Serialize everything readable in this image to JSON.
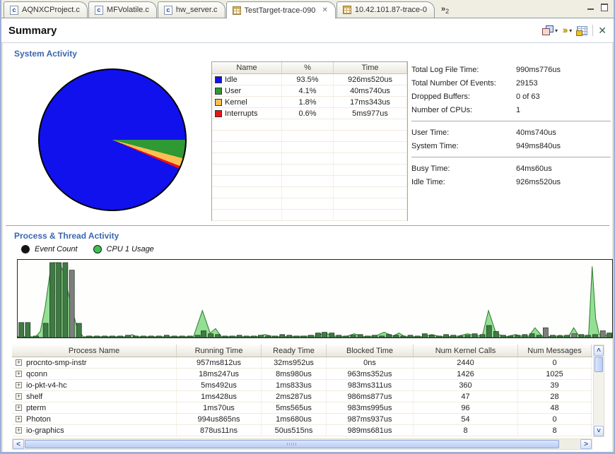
{
  "tabs": [
    {
      "label": "AQNXCProject.c",
      "icon": "c-file-icon",
      "active": false,
      "closable": false
    },
    {
      "label": "MFVolatile.c",
      "icon": "c-file-icon",
      "active": false,
      "closable": false
    },
    {
      "label": "hw_server.c",
      "icon": "c-file-icon",
      "active": false,
      "closable": false
    },
    {
      "label": "TestTarget-trace-090",
      "icon": "trace-file-icon",
      "active": true,
      "closable": true
    },
    {
      "label": "10.42.101.87-trace-0",
      "icon": "trace-file-icon",
      "active": false,
      "closable": false
    }
  ],
  "tab_overflow_count": "2",
  "header": {
    "title": "Summary"
  },
  "icons": {
    "c_glyph": "c",
    "close_tab": "✕",
    "close_view": "✕",
    "dropdown": "▾",
    "overflow_chevron": "»",
    "expand_plus": "+",
    "switch_glyph": "»",
    "vscroll_up": "˄",
    "vscroll_down": "˅",
    "hscroll_left": "˂",
    "hscroll_right": "˃"
  },
  "system_activity": {
    "title": "System Activity",
    "table": {
      "columns": [
        "Name",
        "%",
        "Time"
      ],
      "rows": [
        {
          "name": "Idle",
          "color": "#1111EE",
          "pct": "93.5%",
          "time": "926ms520us"
        },
        {
          "name": "User",
          "color": "#2F9934",
          "pct": "4.1%",
          "time": "40ms740us"
        },
        {
          "name": "Kernel",
          "color": "#FFBE52",
          "pct": "1.8%",
          "time": "17ms343us"
        },
        {
          "name": "Interrupts",
          "color": "#EE1111",
          "pct": "0.6%",
          "time": "5ms977us"
        }
      ]
    },
    "stats": [
      [
        [
          "Total Log File Time:",
          "990ms776us"
        ],
        [
          "Total Number Of Events:",
          "29153"
        ],
        [
          "Dropped Buffers:",
          "0 of 63"
        ],
        [
          "Number of CPUs:",
          "1"
        ]
      ],
      [
        [
          "User Time:",
          "40ms740us"
        ],
        [
          "System Time:",
          "949ms840us"
        ]
      ],
      [
        [
          "Busy Time:",
          "64ms60us"
        ],
        [
          "Idle Time:",
          "926ms520us"
        ]
      ]
    ]
  },
  "process_activity": {
    "title": "Process & Thread Activity",
    "legend": [
      {
        "label": "Event Count",
        "color": "#141414"
      },
      {
        "label": "CPU 1 Usage",
        "color": "#3FC04F"
      }
    ],
    "table": {
      "columns": [
        "Process Name",
        "Running Time",
        "Ready Time",
        "Blocked Time",
        "Num Kernel Calls",
        "Num Messages"
      ],
      "rows": [
        [
          "procnto-smp-instr",
          "957ms812us",
          "32ms952us",
          "0ns",
          "2440",
          "0"
        ],
        [
          "qconn",
          "18ms247us",
          "8ms980us",
          "963ms352us",
          "1426",
          "1025"
        ],
        [
          "io-pkt-v4-hc",
          "5ms492us",
          "1ms833us",
          "983ms311us",
          "360",
          "39"
        ],
        [
          "shelf",
          "1ms428us",
          "2ms287us",
          "986ms877us",
          "47",
          "28"
        ],
        [
          "pterm",
          "1ms70us",
          "5ms565us",
          "983ms995us",
          "96",
          "48"
        ],
        [
          "Photon",
          "994us865ns",
          "1ms680us",
          "987ms937us",
          "54",
          "0"
        ],
        [
          "io-graphics",
          "878us11ns",
          "50us515ns",
          "989ms681us",
          "8",
          "8"
        ]
      ]
    }
  },
  "chart_data": [
    {
      "type": "pie",
      "title": "System Activity",
      "labels": [
        "Idle",
        "User",
        "Kernel",
        "Interrupts"
      ],
      "values": [
        93.5,
        4.1,
        1.8,
        0.6
      ],
      "colors": [
        "#1111EE",
        "#2F9934",
        "#FFBE52",
        "#EE1111"
      ],
      "start_angle": "east",
      "direction": "clockwise",
      "legend_position": "table-right"
    },
    {
      "type": "area+bar",
      "title": "Process & Thread Activity over time",
      "ylim": [
        0,
        100
      ],
      "axes_hidden": true,
      "series": [
        {
          "name": "CPU 1 Usage",
          "type": "area",
          "color": "#93E093",
          "stroke": "#2E7A33",
          "points": [
            [
              0,
              1
            ],
            [
              3,
              1
            ],
            [
              3.8,
              8
            ],
            [
              4.6,
              40
            ],
            [
              5.4,
              85
            ],
            [
              6,
              100
            ],
            [
              7,
              100
            ],
            [
              7.8,
              85
            ],
            [
              8.9,
              45
            ],
            [
              10,
              12
            ],
            [
              11,
              1
            ],
            [
              18.5,
              1
            ],
            [
              19.2,
              4
            ],
            [
              20,
              1
            ],
            [
              29.5,
              1
            ],
            [
              31,
              36
            ],
            [
              32.3,
              6
            ],
            [
              33.2,
              12
            ],
            [
              34.2,
              1
            ],
            [
              40,
              1
            ],
            [
              41.5,
              4
            ],
            [
              43,
              1
            ],
            [
              50,
              2
            ],
            [
              51.5,
              6
            ],
            [
              53,
              2
            ],
            [
              55,
              1
            ],
            [
              56.5,
              5
            ],
            [
              58,
              1
            ],
            [
              60,
              2
            ],
            [
              61.5,
              7
            ],
            [
              63,
              2
            ],
            [
              64,
              6
            ],
            [
              65,
              1
            ],
            [
              68,
              1
            ],
            [
              69.5,
              4
            ],
            [
              71,
              1
            ],
            [
              74,
              2
            ],
            [
              75.5,
              5
            ],
            [
              77,
              2
            ],
            [
              78,
              3
            ],
            [
              79,
              36
            ],
            [
              80.3,
              5
            ],
            [
              82,
              1
            ],
            [
              83.5,
              4
            ],
            [
              85,
              1
            ],
            [
              85.8,
              2
            ],
            [
              86.8,
              13
            ],
            [
              88,
              2
            ],
            [
              90,
              1
            ],
            [
              91,
              3
            ],
            [
              92,
              1
            ],
            [
              92.5,
              2
            ],
            [
              93.3,
              13
            ],
            [
              94.2,
              2
            ],
            [
              95.8,
              2
            ],
            [
              96.4,
              95
            ],
            [
              97,
              25
            ],
            [
              97.6,
              4
            ],
            [
              98.5,
              3
            ],
            [
              100,
              4
            ]
          ]
        },
        {
          "name": "Event Count",
          "type": "bar",
          "color": "#3F7A44",
          "alt_color": "#7E7E7E",
          "points": [
            [
              0.6,
              20
            ],
            [
              1.7,
              20
            ],
            [
              3.1,
              2
            ],
            [
              4.7,
              19
            ],
            [
              5.8,
              100
            ],
            [
              6.9,
              100
            ],
            [
              8,
              100
            ],
            [
              9.1,
              90,
              1
            ],
            [
              10.3,
              19
            ],
            [
              12,
              2
            ],
            [
              13.3,
              2
            ],
            [
              14.6,
              2
            ],
            [
              15.9,
              2
            ],
            [
              17.2,
              2
            ],
            [
              18.5,
              3
            ],
            [
              19.8,
              2
            ],
            [
              21.1,
              2
            ],
            [
              22.4,
              2
            ],
            [
              23.7,
              2
            ],
            [
              25,
              3
            ],
            [
              26.3,
              2
            ],
            [
              27.6,
              2
            ],
            [
              28.9,
              2
            ],
            [
              30.2,
              3
            ],
            [
              31.2,
              9
            ],
            [
              32.4,
              5
            ],
            [
              33.6,
              4
            ],
            [
              34.8,
              2
            ],
            [
              36,
              2
            ],
            [
              37.2,
              3
            ],
            [
              38.4,
              2
            ],
            [
              39.6,
              2
            ],
            [
              40.8,
              3
            ],
            [
              42,
              2
            ],
            [
              43.2,
              2
            ],
            [
              44.4,
              4
            ],
            [
              45.6,
              3
            ],
            [
              46.8,
              2
            ],
            [
              48,
              2
            ],
            [
              49.2,
              3
            ],
            [
              50.4,
              6
            ],
            [
              51.5,
              7
            ],
            [
              52.7,
              6
            ],
            [
              53.9,
              3
            ],
            [
              55.1,
              2
            ],
            [
              56.3,
              3
            ],
            [
              57.5,
              4
            ],
            [
              58.7,
              2
            ],
            [
              59.9,
              3
            ],
            [
              61.1,
              2
            ],
            [
              62.3,
              4
            ],
            [
              63.5,
              3
            ],
            [
              64.7,
              2
            ],
            [
              65.9,
              3
            ],
            [
              67.1,
              2
            ],
            [
              68.3,
              5
            ],
            [
              69.5,
              3
            ],
            [
              70.7,
              2
            ],
            [
              71.9,
              4
            ],
            [
              73.1,
              3
            ],
            [
              74.3,
              2
            ],
            [
              75.5,
              3
            ],
            [
              76.7,
              5
            ],
            [
              78,
              4
            ],
            [
              79.1,
              16
            ],
            [
              80.3,
              8
            ],
            [
              81.5,
              3
            ],
            [
              82.7,
              2
            ],
            [
              83.9,
              3
            ],
            [
              85.1,
              4
            ],
            [
              86.3,
              5
            ],
            [
              87.5,
              3
            ],
            [
              88.6,
              13,
              1
            ],
            [
              89.8,
              3
            ],
            [
              91,
              2
            ],
            [
              92.2,
              3
            ],
            [
              93.4,
              5,
              1
            ],
            [
              94.6,
              4
            ],
            [
              95.7,
              3
            ],
            [
              96.9,
              4
            ],
            [
              98.2,
              9,
              1
            ],
            [
              99.3,
              6
            ]
          ]
        }
      ]
    }
  ]
}
